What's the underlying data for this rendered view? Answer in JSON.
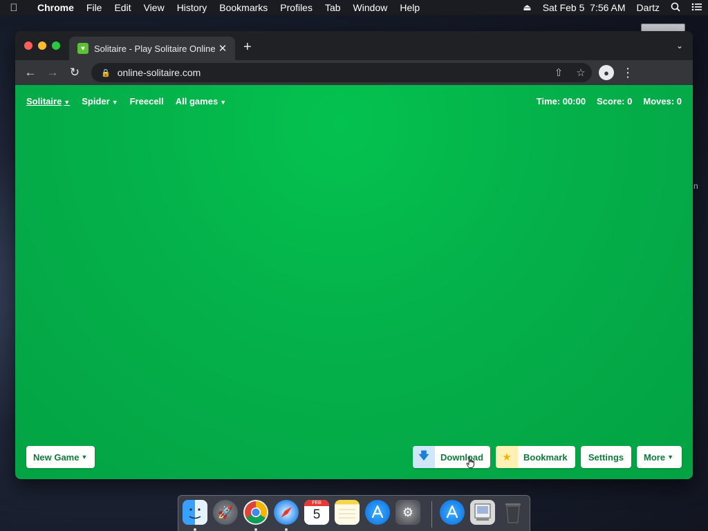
{
  "menubar": {
    "app_name": "Chrome",
    "menus": [
      "File",
      "Edit",
      "View",
      "History",
      "Bookmarks",
      "Profiles",
      "Tab",
      "Window",
      "Help"
    ],
    "datetime": "Sat Feb 5  7:56 AM",
    "user": "Dartz",
    "icons": [
      "apple-icon",
      "eject-icon",
      "spotlight-search-icon",
      "control-center-icon"
    ]
  },
  "desktop": {
    "side_text": "n"
  },
  "browser": {
    "tab_title": "Solitaire - Play Solitaire Online",
    "url": "online-solitaire.com",
    "new_tab_symbol": "+",
    "colors": {
      "frame": "#202124",
      "toolbar": "#35363a"
    }
  },
  "page": {
    "nav": {
      "items": [
        {
          "label": "Solitaire",
          "caret": "▼"
        },
        {
          "label": "Spider",
          "caret": "▼"
        },
        {
          "label": "Freecell"
        },
        {
          "label": "All games",
          "caret": "▼"
        }
      ]
    },
    "stats": {
      "time": "Time: 00:00",
      "score": "Score: 0",
      "moves": "Moves: 0"
    },
    "buttons": {
      "new_game": "New Game",
      "download": "Download",
      "bookmark": "Bookmark",
      "settings": "Settings",
      "more": "More",
      "caret": "▼"
    },
    "colors": {
      "felt": "#04b04a",
      "button_text": "#0f7a3a"
    }
  },
  "dock": {
    "apps": [
      "Finder",
      "Launchpad",
      "Google Chrome",
      "Safari",
      "Calendar",
      "Notes",
      "App Store",
      "System Preferences",
      "App Store",
      "Migration Assistant",
      "Trash"
    ],
    "calendar_month": "FEB",
    "calendar_day": "5"
  }
}
